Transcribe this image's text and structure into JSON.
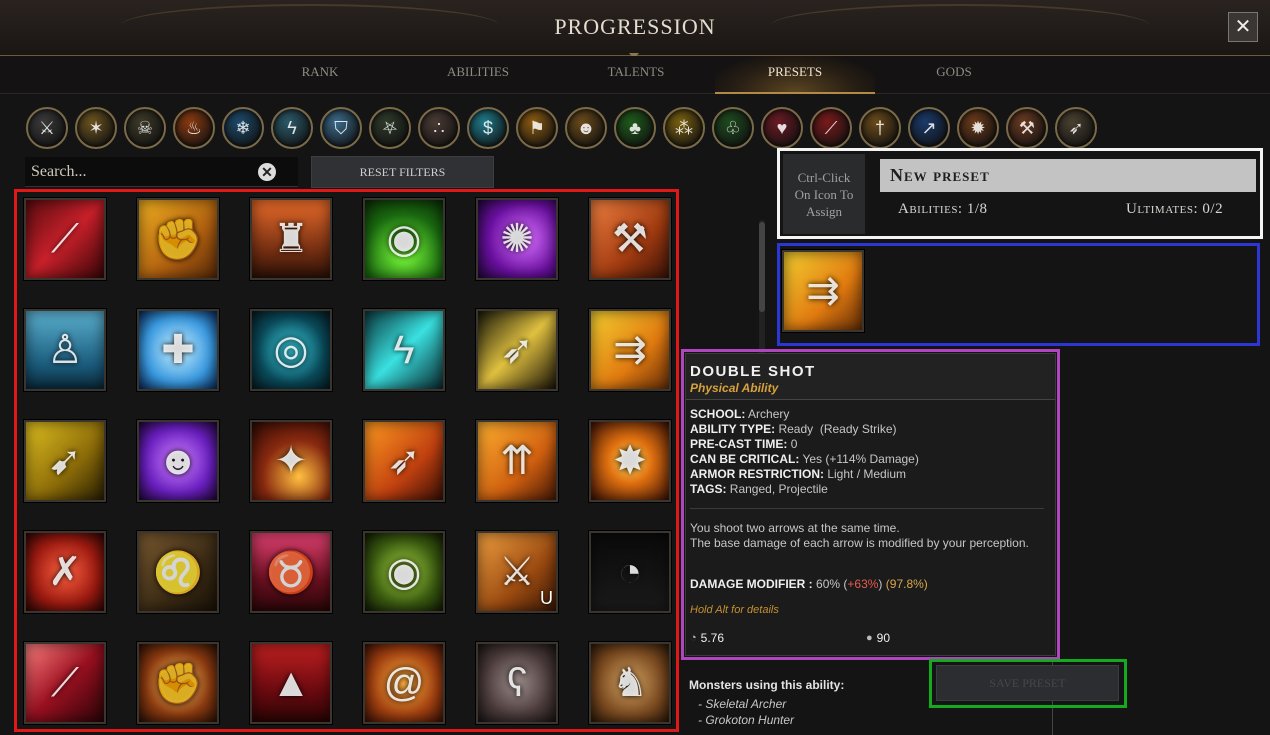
{
  "header": {
    "title": "PROGRESSION",
    "close_label": "✕"
  },
  "tabs": [
    {
      "label": "RANK",
      "active": false
    },
    {
      "label": "ABILITIES",
      "active": false
    },
    {
      "label": "TALENTS",
      "active": false
    },
    {
      "label": "PRESETS",
      "active": true
    },
    {
      "label": "GODS",
      "active": false
    }
  ],
  "filters": [
    {
      "icon": "crossed-swords-icon",
      "glyph": "⚔",
      "color": "#3a3a3a"
    },
    {
      "icon": "beast-claw-icon",
      "glyph": "✶",
      "color": "#6a5320"
    },
    {
      "icon": "skull-icon",
      "glyph": "☠",
      "color": "#3d3a28"
    },
    {
      "icon": "fire-icon",
      "glyph": "♨",
      "color": "#8a3a10"
    },
    {
      "icon": "ice-icon",
      "glyph": "❄",
      "color": "#1d4a6a"
    },
    {
      "icon": "lightning-icon",
      "glyph": "ϟ",
      "color": "#2c5a6a"
    },
    {
      "icon": "shield-icon",
      "glyph": "⛉",
      "color": "#3a6a8a"
    },
    {
      "icon": "pentagram-icon",
      "glyph": "⛧",
      "color": "#2e3a2a"
    },
    {
      "icon": "orbs-icon",
      "glyph": "∴",
      "color": "#4a3a34"
    },
    {
      "icon": "serpent-icon",
      "glyph": "$",
      "color": "#1e7a8a"
    },
    {
      "icon": "banner-icon",
      "glyph": "⚑",
      "color": "#8a5a10"
    },
    {
      "icon": "mask-icon",
      "glyph": "☻",
      "color": "#6a4a1a"
    },
    {
      "icon": "poison-drops-icon",
      "glyph": "♣",
      "color": "#1f5a1a"
    },
    {
      "icon": "coins-icon",
      "glyph": "⁂",
      "color": "#7a6010"
    },
    {
      "icon": "nature-skull-icon",
      "glyph": "♧",
      "color": "#1e4a1e"
    },
    {
      "icon": "blood-icon",
      "glyph": "♥",
      "color": "#6a1a24"
    },
    {
      "icon": "dagger-icon",
      "glyph": "⟋",
      "color": "#7a1a1a"
    },
    {
      "icon": "sword-icon",
      "glyph": "†",
      "color": "#6a4a1a"
    },
    {
      "icon": "spear-icon",
      "glyph": "↗",
      "color": "#1a3a6a"
    },
    {
      "icon": "mace-icon",
      "glyph": "✹",
      "color": "#6a3a1a"
    },
    {
      "icon": "axe-icon",
      "glyph": "⚒",
      "color": "#6a3a20"
    },
    {
      "icon": "arrow-icon",
      "glyph": "➶",
      "color": "#4a4030"
    }
  ],
  "search": {
    "placeholder": "Search...",
    "clear_label": "✕"
  },
  "reset_filters_label": "RESET FILTERS",
  "abilities": [
    {
      "name": "bloody-slash",
      "glyph": "⟋",
      "bg": "linear-gradient(135deg,#5a0c10,#c8202a 50%,#3a0608)"
    },
    {
      "name": "shield-bash",
      "glyph": "✊",
      "bg": "linear-gradient(135deg,#f0b020,#b06010 60%,#5a2a08)"
    },
    {
      "name": "war-banner",
      "glyph": "♜",
      "bg": "linear-gradient(180deg,#e86a2a,#6a2a10 70%,#2a1008)"
    },
    {
      "name": "acid-pool",
      "glyph": "◉",
      "bg": "radial-gradient(circle at 50% 70%,#7aff3a,#1a6a10 60%,#0a2a06)"
    },
    {
      "name": "arcane-orb",
      "glyph": "✺",
      "bg": "radial-gradient(circle at 60% 50%,#d870ff,#6a10a0 60%,#20063a)"
    },
    {
      "name": "hammer-strike",
      "glyph": "⚒",
      "bg": "linear-gradient(135deg,#f08040,#a03a10 60%,#3a1408)"
    },
    {
      "name": "armor-stance",
      "glyph": "♙",
      "bg": "linear-gradient(180deg,#5ab0d0,#1a5a7a 70%,#0a2a3a)"
    },
    {
      "name": "holy-cross",
      "glyph": "✚",
      "bg": "radial-gradient(circle,#c8f0ff,#3a9ae0 60%,#0a2a5a)"
    },
    {
      "name": "energy-ward",
      "glyph": "◎",
      "bg": "radial-gradient(circle,#3ad0e0,#0a4a5a 60%,#061a20)"
    },
    {
      "name": "lightning-strike",
      "glyph": "ϟ",
      "bg": "linear-gradient(135deg,#0a3a40,#3ae0e0 50%,#0a2a30)"
    },
    {
      "name": "piercing-shot",
      "glyph": "➶",
      "bg": "linear-gradient(135deg,#1a1a0a,#e0c040 50%,#1a1408)"
    },
    {
      "name": "double-shot",
      "glyph": "⇉",
      "bg": "linear-gradient(135deg,#f5d030,#e07a10 60%,#6a3008)"
    },
    {
      "name": "golden-arrow",
      "glyph": "➹",
      "bg": "linear-gradient(135deg,#e0c020,#8a6a08 60%,#2a2004)"
    },
    {
      "name": "shadow-roar",
      "glyph": "☻",
      "bg": "radial-gradient(circle,#d080ff,#6a20c0 60%,#20063a)"
    },
    {
      "name": "meteor",
      "glyph": "✦",
      "bg": "radial-gradient(circle at 60% 70%,#ffc040,#8a2a10 50%,#2a0804)"
    },
    {
      "name": "fire-arrow",
      "glyph": "➶",
      "bg": "linear-gradient(135deg,#ff9a20,#c04010 60%,#3a1006)"
    },
    {
      "name": "multi-shot",
      "glyph": "⇈",
      "bg": "linear-gradient(135deg,#ffb030,#d06010 60%,#4a1a06)"
    },
    {
      "name": "explosion",
      "glyph": "✸",
      "bg": "radial-gradient(circle,#ffe060,#e07010 40%,#3a1006)"
    },
    {
      "name": "shatter",
      "glyph": "✗",
      "bg": "radial-gradient(circle,#ff6040,#9a1a10 60%,#2a0604)"
    },
    {
      "name": "lion-roar",
      "glyph": "♌",
      "bg": "linear-gradient(135deg,#7a5a30,#3a2a14 60%,#1a1208)"
    },
    {
      "name": "savage-bite",
      "glyph": "♉",
      "bg": "linear-gradient(180deg,#e04070,#6a1020 60%,#2a0608)"
    },
    {
      "name": "eagle-eye",
      "glyph": "◉",
      "bg": "radial-gradient(circle,#a0d040,#3a5a10 60%,#101a04)"
    },
    {
      "name": "cleave",
      "glyph": "⚔",
      "bg": "linear-gradient(135deg,#f0a040,#9a4a10 60%,#3a1806)",
      "badge": "U"
    },
    {
      "name": "night-eyes",
      "glyph": "◔",
      "bg": "linear-gradient(180deg,#0a0a0a,#1a1a1a)"
    },
    {
      "name": "crimson-slash",
      "glyph": "⟋",
      "bg": "linear-gradient(135deg,#ff8080,#9a1020 50%,#2a0408)"
    },
    {
      "name": "ground-slam",
      "glyph": "✊",
      "bg": "radial-gradient(circle,#ffc060,#8a3a10 60%,#2a1006)"
    },
    {
      "name": "blood-spike",
      "glyph": "▲",
      "bg": "linear-gradient(180deg,#c02020,#6a0a10 60%,#2a0404)"
    },
    {
      "name": "whirlwind",
      "glyph": "@",
      "bg": "radial-gradient(circle,#ffb040,#a04010 60%,#3a1006)"
    },
    {
      "name": "bear-form",
      "glyph": "ʕ",
      "bg": "radial-gradient(circle,#9a8a8a,#4a3a3a 60%,#1a1414)"
    },
    {
      "name": "wolf-form",
      "glyph": "♞",
      "bg": "radial-gradient(circle,#d0a060,#7a4a20 60%,#2a1808)"
    }
  ],
  "preset": {
    "hint": "Ctrl-Click On Icon To Assign",
    "name": "New preset",
    "abilities_label": "Abilities: 1/8",
    "ultimates_label": "Ultimates: 0/2"
  },
  "tooltip": {
    "name": "DOUBLE SHOT",
    "type": "Physical Ability",
    "school_key": "SCHOOL:",
    "school_val": "Archery",
    "ability_type_key": "ABILITY TYPE:",
    "ability_type_val": "Ready  (Ready Strike)",
    "precast_key": "PRE-CAST TIME:",
    "precast_val": "0",
    "critical_key": "CAN BE CRITICAL:",
    "critical_val": "Yes (+114% Damage)",
    "armor_key": "ARMOR RESTRICTION:",
    "armor_val": "Light / Medium",
    "tags_key": "TAGS:",
    "tags_val": "Ranged, Projectile",
    "desc_1": "You shoot two arrows at the same time.",
    "desc_2": "The base damage of each arrow is modified by your perception.",
    "modifier_key": "DAMAGE MODIFIER :",
    "modifier_base": "60%",
    "modifier_bonus": "+63%",
    "modifier_total": "97.8%",
    "hold_alt": "Hold Alt for details",
    "cooldown": "5.76",
    "cost": "90"
  },
  "monsters": {
    "title": "Monsters using this ability:",
    "list": [
      "- Skeletal Archer",
      "- Grokoton Hunter"
    ]
  },
  "save_preset_label": "SAVE PRESET"
}
